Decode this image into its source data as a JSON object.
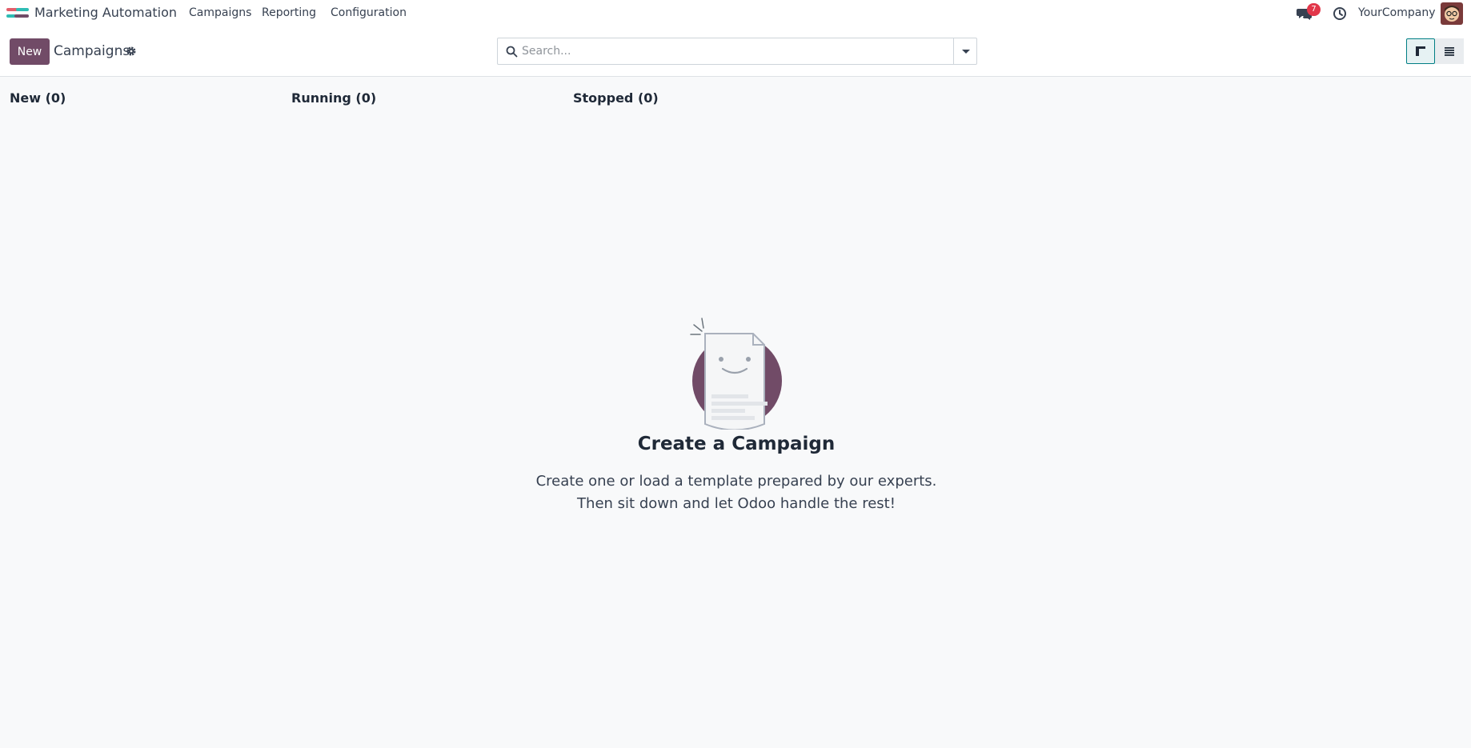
{
  "navbar": {
    "app_name": "Marketing Automation",
    "menus": [
      "Campaigns",
      "Reporting",
      "Configuration"
    ],
    "messages_count": "7",
    "company": "YourCompany"
  },
  "control_panel": {
    "new_label": "New",
    "breadcrumb": "Campaigns",
    "search_placeholder": "Search..."
  },
  "kanban": {
    "columns": [
      "New (0)",
      "Running (0)",
      "Stopped (0)"
    ]
  },
  "helper": {
    "title": "Create a Campaign",
    "line1": "Create one or load a template prepared by our experts.",
    "line2": "Then sit down and let Odoo handle the rest!"
  },
  "colors": {
    "primary": "#714b67",
    "accent": "#017e84",
    "badge": "#e2374a"
  },
  "icons": {
    "app": "marketing-automation-logo-icon",
    "chat": "chat-bubbles-icon",
    "activity": "clock-icon",
    "settings": "gear-icon",
    "search": "magnifier-icon",
    "kanban_view": "kanban-view-icon",
    "list_view": "list-view-icon"
  }
}
